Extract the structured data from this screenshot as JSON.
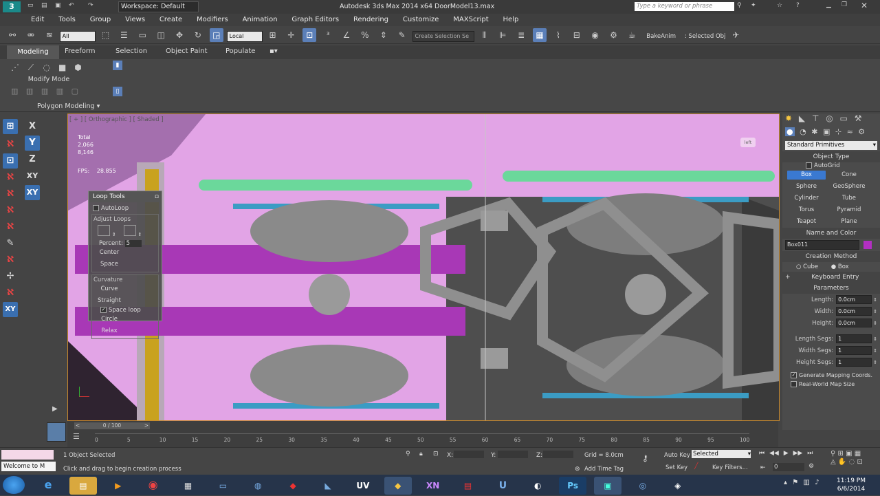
{
  "window": {
    "workspace": "Workspace: Default",
    "title": "Autodesk 3ds Max  2014 x64    DoorModel13.max",
    "search_placeholder": "Type a keyword or phrase"
  },
  "menu": [
    "Edit",
    "Tools",
    "Group",
    "Views",
    "Create",
    "Modifiers",
    "Animation",
    "Graph Editors",
    "Rendering",
    "Customize",
    "MAXScript",
    "Help"
  ],
  "toolbar": {
    "selection_filter": "All",
    "ref_coord": "Local",
    "named_selection": "Create Selection Se",
    "bake_anim": "BakeAnim",
    "selected_obj": ": Selected Obj"
  },
  "ribbon": {
    "tabs": [
      "Modeling",
      "Freeform",
      "Selection",
      "Object Paint",
      "Populate"
    ],
    "modify_mode": "Modify Mode",
    "polygon_modeling": "Polygon Modeling"
  },
  "left_toolbar": [
    "X",
    "Y",
    "Z",
    "XY",
    "XY"
  ],
  "viewport": {
    "label": "[ + ] [ Orthographic ] [ Shaded ]",
    "stats": [
      "Total",
      "2,066",
      "8,146"
    ],
    "fps_label": "FPS:",
    "fps_value": "28.855",
    "viewcube": "left"
  },
  "loop_tools": {
    "title": "Loop Tools",
    "autoloop": "AutoLoop",
    "adjust_loops": "Adjust Loops",
    "percent_label": "Percent:",
    "percent_value": "5",
    "center": "Center",
    "space": "Space",
    "curvature": "Curvature",
    "curve": "Curve",
    "straight": "Straight",
    "space_loop": "Space loop",
    "circle": "Circle",
    "relax": "Relax"
  },
  "command_panel": {
    "category": "Standard Primitives",
    "object_type": "Object Type",
    "autogrid": "AutoGrid",
    "buttons": [
      "Box",
      "Cone",
      "Sphere",
      "GeoSphere",
      "Cylinder",
      "Tube",
      "Torus",
      "Pyramid",
      "Teapot",
      "Plane"
    ],
    "name_and_color": "Name and Color",
    "object_name": "Box011",
    "object_color": "#b32fc2",
    "creation_method": "Creation Method",
    "cube": "Cube",
    "box": "Box",
    "keyboard_entry": "Keyboard Entry",
    "parameters": "Parameters",
    "params": [
      {
        "label": "Length:",
        "value": "0.0cm"
      },
      {
        "label": "Width:",
        "value": "0.0cm"
      },
      {
        "label": "Height:",
        "value": "0.0cm"
      },
      {
        "label": "Length Segs:",
        "value": "1"
      },
      {
        "label": "Width Segs:",
        "value": "1"
      },
      {
        "label": "Height Segs:",
        "value": "1"
      }
    ],
    "gen_mapping": "Generate Mapping Coords.",
    "real_world": "Real-World Map Size"
  },
  "timeline": {
    "frame": "0 / 100",
    "ticks": [
      "0",
      "5",
      "10",
      "15",
      "20",
      "25",
      "30",
      "35",
      "40",
      "45",
      "50",
      "55",
      "60",
      "65",
      "70",
      "75",
      "80",
      "85",
      "90",
      "95",
      "100"
    ]
  },
  "status": {
    "maxscript": "Welcome to M",
    "selected": "1 Object Selected",
    "prompt": "Click and drag to begin creation process",
    "x_label": "X:",
    "y_label": "Y:",
    "z_label": "Z:",
    "grid": "Grid = 8.0cm",
    "add_time_tag": "Add Time Tag",
    "auto_key": "Auto Key",
    "set_key": "Set Key",
    "key_mode": "Selected",
    "key_filters": "Key Filters...",
    "frame": "0"
  },
  "taskbar": {
    "apps": [
      "ie",
      "explorer",
      "media",
      "chrome",
      "docs",
      "outlook",
      "cmd",
      "max",
      "xsi",
      "xn",
      "vs",
      "unity",
      "steam",
      "ps",
      "max2",
      "wmp",
      "app"
    ],
    "app_labels": {
      "uv": "UV",
      "xn": "XN",
      "ps": "Ps"
    },
    "time": "11:19 PM",
    "date": "6/6/2014"
  }
}
